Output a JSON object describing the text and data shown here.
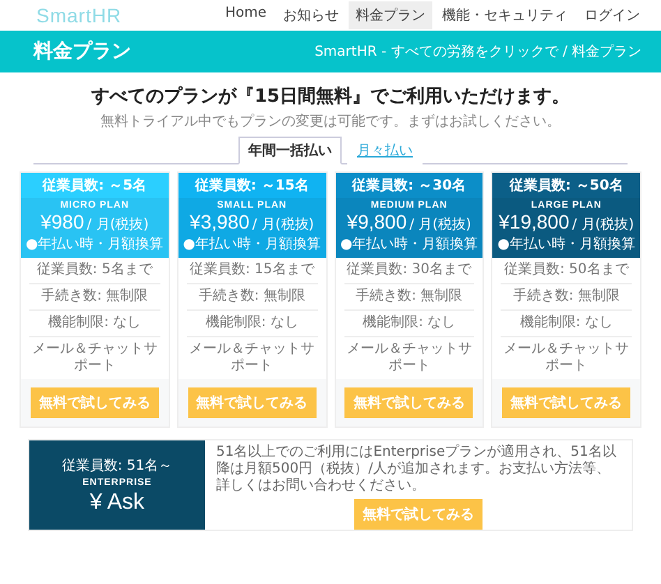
{
  "header": {
    "logo": "SmartHR",
    "nav": [
      {
        "label": "Home",
        "selected": false
      },
      {
        "label": "お知らせ",
        "selected": false
      },
      {
        "label": "料金プラン",
        "selected": true
      },
      {
        "label": "機能・セキュリティ",
        "selected": false
      },
      {
        "label": "ログイン",
        "selected": false
      }
    ]
  },
  "banner": {
    "title": "料金プラン",
    "breadcrumb": "SmartHR - すべての労務をクリックで / 料金プラン"
  },
  "headline": "すべてのプランが『15日間無料』でご利用いただけます。",
  "subtitle": "無料トライアル中でもプランの変更は可能です。まずはお試しください。",
  "tabs": [
    {
      "label": "年間一括払い",
      "selected": true
    },
    {
      "label": "月々払い",
      "selected": false
    }
  ],
  "plans": [
    {
      "employees": "従業員数: ～5名",
      "name": "MICRO PLAN",
      "price": "¥980",
      "unit": "/ 月(税抜)",
      "note": "●年払い時・月額換算",
      "color": "#29c3f3",
      "features": [
        "従業員数: 5名まで",
        "手続き数: 無制限",
        "機能制限: なし",
        "メール＆チャットサポート"
      ],
      "button": "無料で試してみる"
    },
    {
      "employees": "従業員数: ～15名",
      "name": "SMALL PLAN",
      "price": "¥3,980",
      "unit": "/ 月(税抜)",
      "note": "●年払い時・月額換算",
      "color": "#0fa9e4",
      "features": [
        "従業員数: 15名まで",
        "手続き数: 無制限",
        "機能制限: なし",
        "メール＆チャットサポート"
      ],
      "button": "無料で試してみる"
    },
    {
      "employees": "従業員数: ～30名",
      "name": "MEDIUM PLAN",
      "price": "¥9,800",
      "unit": "/ 月(税抜)",
      "note": "●年払い時・月額換算",
      "color": "#0b86bd",
      "features": [
        "従業員数: 30名まで",
        "手続き数: 無制限",
        "機能制限: なし",
        "メール＆チャットサポート"
      ],
      "button": "無料で試してみる"
    },
    {
      "employees": "従業員数: ～50名",
      "name": "LARGE PLAN",
      "price": "¥19,800",
      "unit": "/ 月(税抜)",
      "note": "●年払い時・月額換算",
      "color": "#0b5a80",
      "features": [
        "従業員数: 50名まで",
        "手続き数: 無制限",
        "機能制限: なし",
        "メール＆チャットサポート"
      ],
      "button": "無料で試してみる"
    }
  ],
  "enterprise": {
    "employees": "従業員数: 51名～",
    "name": "ENTERPRISE",
    "price": "¥ Ask",
    "description": "51名以上でのご利用にはEnterpriseプランが適用され、51名以降は月額500円（税抜）/人が追加されます。お支払い方法等、詳しくはお問い合わせください。",
    "button": "無料で試してみる"
  }
}
